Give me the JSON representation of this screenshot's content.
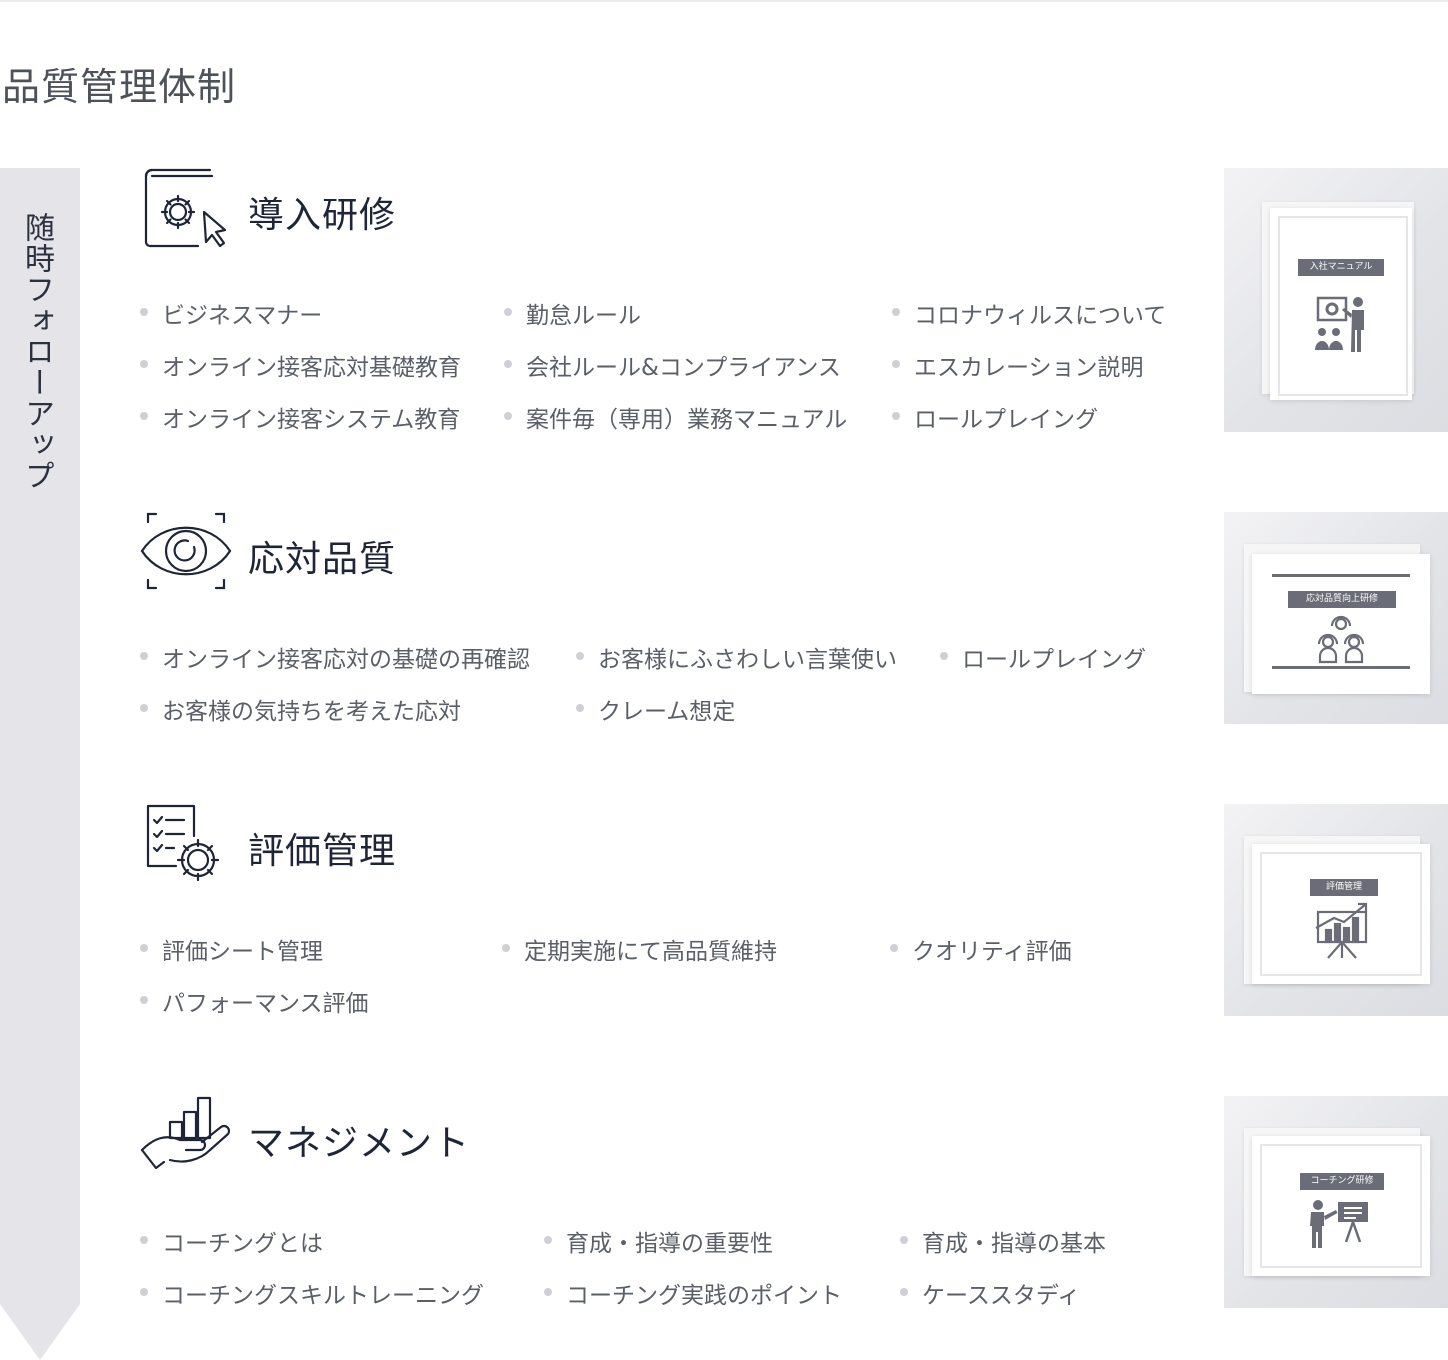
{
  "page_title": "品質管理体制",
  "follow_up_label": "随時フォローアップ",
  "sections": [
    {
      "title": "導入研修",
      "icon": "manual-gear-cursor-icon",
      "items": [
        "ビジネスマナー",
        "勤怠ルール",
        "コロナウィルスについて",
        "オンライン接客応対基礎教育",
        "会社ルール&コンプライアンス",
        "エスカレーション説明",
        "オンライン接客システム教育",
        "案件毎（専用）業務マニュアル",
        "ロールプレイング"
      ],
      "thumb_label": "入社マニュアル"
    },
    {
      "title": "応対品質",
      "icon": "eye-focus-icon",
      "items": [
        "オンライン接客応対の基礎の再確認",
        "お客様にふさわしい言葉使い",
        "ロールプレイング",
        "お客様の気持ちを考えた応対",
        "クレーム想定"
      ],
      "thumb_label": "応対品質向上研修"
    },
    {
      "title": "評価管理",
      "icon": "checklist-gear-icon",
      "items": [
        "評価シート管理",
        "定期実施にて高品質維持",
        "クオリティ評価",
        "パフォーマンス評価"
      ],
      "thumb_label": "評価管理"
    },
    {
      "title": "マネジメント",
      "icon": "hand-chart-icon",
      "items": [
        "コーチングとは",
        "育成・指導の重要性",
        "育成・指導の基本",
        "コーチングスキルトレーニング",
        "コーチング実践のポイント",
        "ケーススタディ"
      ],
      "thumb_label": "コーチング研修"
    }
  ],
  "colors": {
    "arrow": "#e4e4e9",
    "title_text": "#1f2538",
    "body_text": "#5a5f68",
    "bullet": "#cfd0d5",
    "thumb_label_bg": "#6a6d78",
    "icon_stroke": "#1f2538"
  }
}
